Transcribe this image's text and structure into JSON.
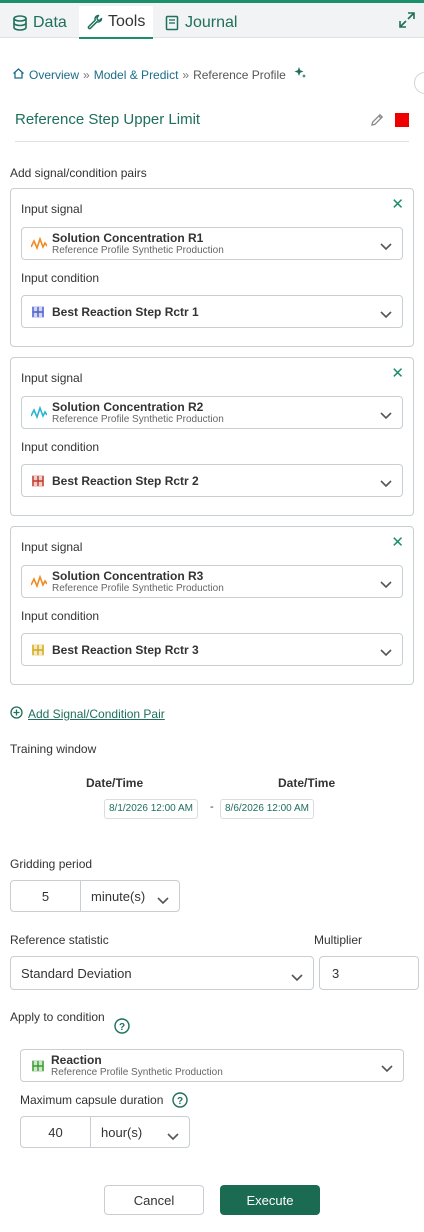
{
  "tabs": [
    {
      "label": "Data",
      "icon": "database-icon"
    },
    {
      "label": "Tools",
      "icon": "wrench-icon"
    },
    {
      "label": "Journal",
      "icon": "book-icon"
    }
  ],
  "breadcrumb": {
    "home": "Overview",
    "middle": "Model & Predict",
    "current": "Reference Profile"
  },
  "item": {
    "title": "Reference Step Upper Limit",
    "color": "#ee0000"
  },
  "pairs_label": "Add signal/condition pairs",
  "input_signal_label": "Input signal",
  "input_condition_label": "Input condition",
  "pairs": [
    {
      "signal_name": "Solution Concentration R1",
      "signal_sub": "Reference Profile Synthetic Production",
      "signal_color": "#f08a24",
      "condition_name": "Best Reaction Step Rctr 1",
      "condition_color": "#4a5fc9"
    },
    {
      "signal_name": "Solution Concentration R2",
      "signal_sub": "Reference Profile Synthetic Production",
      "signal_color": "#2cb5cc",
      "condition_name": "Best Reaction Step Rctr 2",
      "condition_color": "#c0392b"
    },
    {
      "signal_name": "Solution Concentration R3",
      "signal_sub": "Reference Profile Synthetic Production",
      "signal_color": "#f08a24",
      "condition_name": "Best Reaction Step Rctr 3",
      "condition_color": "#d4a916"
    }
  ],
  "add_pair_link": "Add Signal/Condition Pair",
  "training": {
    "label": "Training window",
    "start_header": "Date/Time",
    "end_header": "Date/Time",
    "start": "8/1/2026 12:00 AM",
    "separator": "-",
    "end": "8/6/2026 12:00 AM"
  },
  "gridding": {
    "label": "Gridding period",
    "value": "5",
    "unit": "minute(s)"
  },
  "statistic": {
    "label": "Reference statistic",
    "value": "Standard Deviation",
    "multiplier_label": "Multiplier",
    "multiplier": "3"
  },
  "apply": {
    "label": "Apply to condition",
    "condition_name": "Reaction",
    "condition_sub": "Reference Profile Synthetic Production",
    "condition_color": "#3a9a2f",
    "max_duration_label": "Maximum capsule duration",
    "max_duration_value": "40",
    "max_duration_unit": "hour(s)"
  },
  "buttons": {
    "cancel": "Cancel",
    "execute": "Execute"
  },
  "accent": "#1b8f6a"
}
